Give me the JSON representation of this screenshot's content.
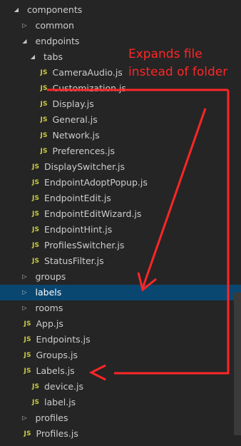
{
  "explorer": {
    "items": [
      {
        "type": "folder",
        "open": true,
        "depth": 0,
        "label": "components"
      },
      {
        "type": "folder",
        "open": false,
        "depth": 1,
        "label": "common"
      },
      {
        "type": "folder",
        "open": true,
        "depth": 1,
        "label": "endpoints"
      },
      {
        "type": "folder",
        "open": true,
        "depth": 2,
        "label": "tabs"
      },
      {
        "type": "file",
        "depth": 3,
        "icon": "JS",
        "label": "CameraAudio.js"
      },
      {
        "type": "file",
        "depth": 3,
        "icon": "JS",
        "label": "Customization.js"
      },
      {
        "type": "file",
        "depth": 3,
        "icon": "JS",
        "label": "Display.js"
      },
      {
        "type": "file",
        "depth": 3,
        "icon": "JS",
        "label": "General.js"
      },
      {
        "type": "file",
        "depth": 3,
        "icon": "JS",
        "label": "Network.js"
      },
      {
        "type": "file",
        "depth": 3,
        "icon": "JS",
        "label": "Preferences.js"
      },
      {
        "type": "file",
        "depth": 2,
        "icon": "JS",
        "label": "DisplaySwitcher.js"
      },
      {
        "type": "file",
        "depth": 2,
        "icon": "JS",
        "label": "EndpointAdoptPopup.js"
      },
      {
        "type": "file",
        "depth": 2,
        "icon": "JS",
        "label": "EndpointEdit.js"
      },
      {
        "type": "file",
        "depth": 2,
        "icon": "JS",
        "label": "EndpointEditWizard.js"
      },
      {
        "type": "file",
        "depth": 2,
        "icon": "JS",
        "label": "EndpointHint.js"
      },
      {
        "type": "file",
        "depth": 2,
        "icon": "JS",
        "label": "ProfilesSwitcher.js"
      },
      {
        "type": "file",
        "depth": 2,
        "icon": "JS",
        "label": "StatusFilter.js"
      },
      {
        "type": "folder",
        "open": false,
        "depth": 1,
        "label": "groups"
      },
      {
        "type": "folder",
        "open": false,
        "depth": 1,
        "label": "labels",
        "selected": true
      },
      {
        "type": "folder",
        "open": false,
        "depth": 1,
        "label": "rooms"
      },
      {
        "type": "file",
        "depth": 1,
        "icon": "JS",
        "label": "App.js"
      },
      {
        "type": "file",
        "depth": 1,
        "icon": "JS",
        "label": "Endpoints.js"
      },
      {
        "type": "file",
        "depth": 1,
        "icon": "JS",
        "label": "Groups.js"
      },
      {
        "type": "file",
        "depth": 1,
        "icon": "JS",
        "label": "Labels.js"
      },
      {
        "type": "file",
        "depth": 2,
        "icon": "JS",
        "label": "device.js"
      },
      {
        "type": "file",
        "depth": 2,
        "icon": "JS",
        "label": "label.js"
      },
      {
        "type": "folder",
        "open": false,
        "depth": 1,
        "label": "profiles"
      },
      {
        "type": "file",
        "depth": 1,
        "icon": "JS",
        "label": "Profiles.js"
      }
    ]
  },
  "annotation": {
    "line1": "Expands file",
    "line2": "instead of folder",
    "color": "#ff2626"
  },
  "colors": {
    "background": "#252526",
    "selected": "#094771",
    "js_icon": "#cbcb41"
  }
}
